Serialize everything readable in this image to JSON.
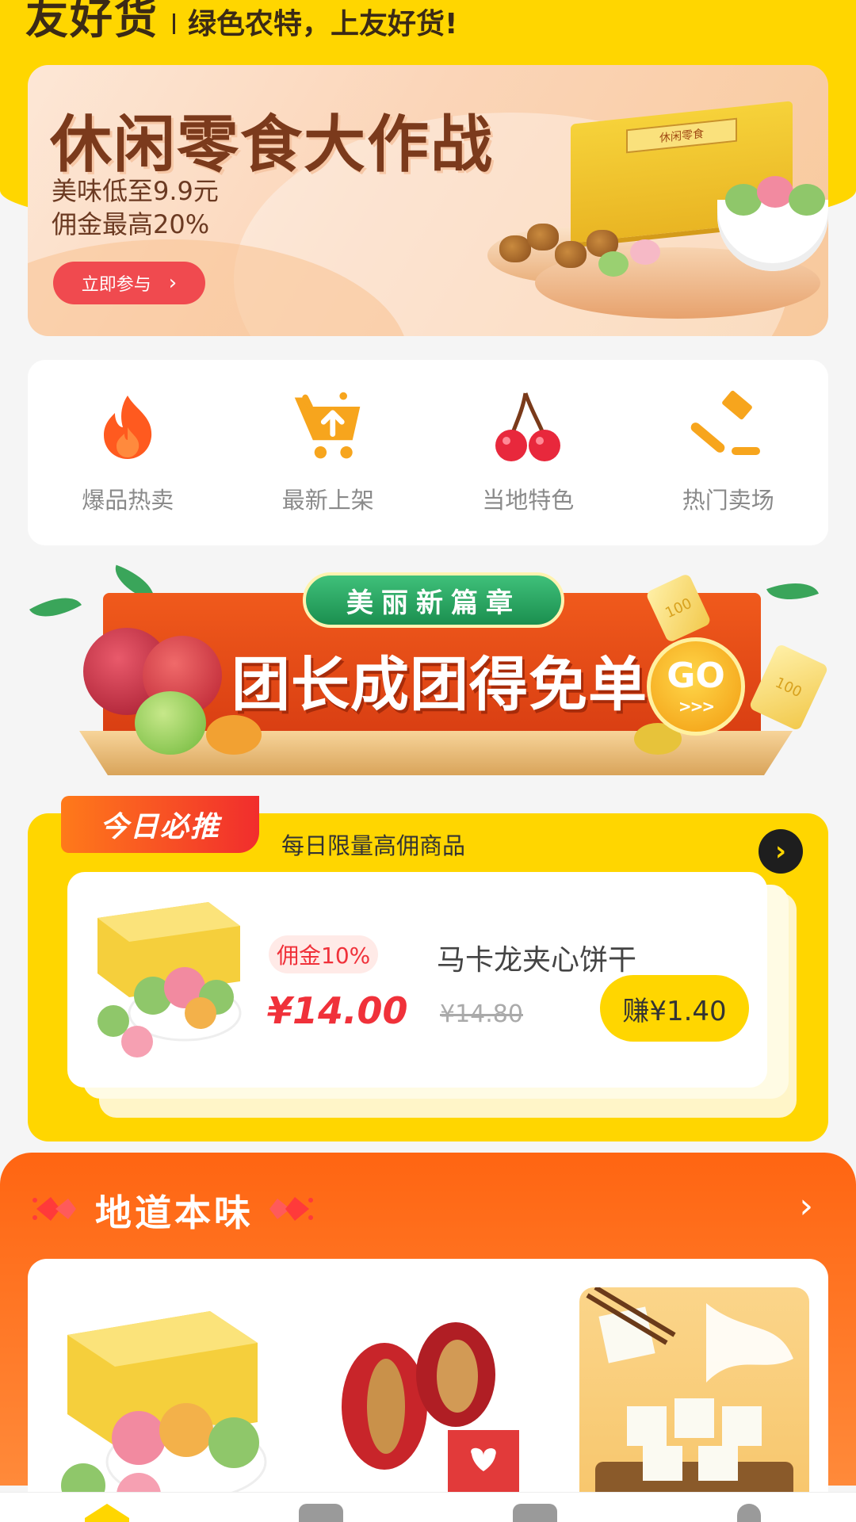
{
  "header": {
    "logo": "友好货",
    "slogan": "绿色农特，上友好货!"
  },
  "banner_snacks": {
    "title": "休闲零食大作战",
    "line1": "美味低至9.9元",
    "line2": "佣金最高20%",
    "button_label": "立即参与",
    "button_chevron": "›",
    "box_label": "休闲零食"
  },
  "categories": [
    {
      "label": "爆品热卖",
      "icon": "fire-icon",
      "color": "#ff5a1f"
    },
    {
      "label": "最新上架",
      "icon": "shopping-cart-icon",
      "color": "#f7a51d"
    },
    {
      "label": "当地特色",
      "icon": "cherry-icon",
      "color": "#e8283c"
    },
    {
      "label": "热门卖场",
      "icon": "auction-hammer-icon",
      "color": "#f7a51d"
    }
  ],
  "banner_group": {
    "pill": "美丽新篇章",
    "main": "团长成团得免单",
    "go": "GO",
    "go_arrows": ">>>",
    "coin": "100"
  },
  "today": {
    "tag": "今日必推",
    "subtitle": "每日限量高佣商品",
    "arrow": "›",
    "product": {
      "commission": "佣金10%",
      "name": "马卡龙夹心饼干",
      "price": "¥14.00",
      "original_price": "¥14.80",
      "earn": "赚¥1.40"
    }
  },
  "local": {
    "title": "地道本味",
    "chevron": "›",
    "items": [
      {
        "name": "macaron-box"
      },
      {
        "name": "walnut-dates"
      },
      {
        "name": "milk-cake"
      }
    ]
  },
  "colors": {
    "brand_yellow": "#ffd600",
    "accent_red": "#f0313a",
    "orange": "#ff6512"
  }
}
